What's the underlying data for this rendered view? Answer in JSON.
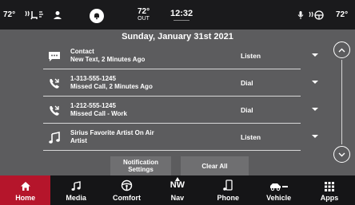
{
  "status_bar": {
    "temp_left": "72°",
    "temp_out": "72°",
    "temp_out_label": "OUT",
    "time": "12:32",
    "temp_right": "72°"
  },
  "panel": {
    "date": "Sunday, January 31st 2021",
    "notifications": [
      {
        "icon": "message-icon",
        "line1": "Contact",
        "line2": "New Text, 2 Minutes Ago",
        "action": "Listen"
      },
      {
        "icon": "missed-call-icon",
        "line1": "1-313-555-1245",
        "line2": "Missed Call, 2 Minutes Ago",
        "action": "Dial"
      },
      {
        "icon": "missed-call-icon",
        "line1": "1-212-555-1245",
        "line2": "Missed Call - Work",
        "action": "Dial"
      },
      {
        "icon": "music-note-icon",
        "line1": "Sirius Favorite Artist On Air",
        "line2": "Artist",
        "action": "Listen"
      }
    ],
    "buttons": {
      "notification_settings_line1": "Notification",
      "notification_settings_line2": "Settings",
      "clear_all": "Clear All"
    }
  },
  "nav": {
    "items": [
      {
        "label": "Home",
        "icon": "home-icon",
        "active": true
      },
      {
        "label": "Media",
        "icon": "music-note-icon",
        "active": false
      },
      {
        "label": "Comfort",
        "icon": "steering-wheel-icon",
        "active": false
      },
      {
        "label": "Nav",
        "icon": "compass-icon",
        "active": false,
        "heading": "NW"
      },
      {
        "label": "Phone",
        "icon": "phone-icon",
        "active": false
      },
      {
        "label": "Vehicle",
        "icon": "vehicle-icon",
        "active": false
      },
      {
        "label": "Apps",
        "icon": "apps-grid-icon",
        "active": false
      }
    ]
  },
  "colors": {
    "accent": "#b5152b",
    "panel": "#5c5c5e",
    "bar": "#1a1a1c"
  }
}
